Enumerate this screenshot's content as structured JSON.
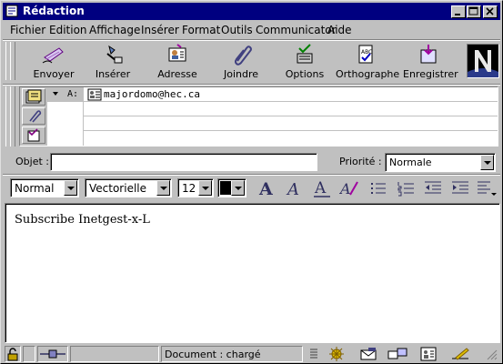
{
  "window": {
    "title": "Rédaction"
  },
  "menu": [
    {
      "label": "Fichier"
    },
    {
      "label": "Edition"
    },
    {
      "label": "Affichage"
    },
    {
      "label": "Insérer"
    },
    {
      "label": "Format"
    },
    {
      "label": "Outils"
    },
    {
      "label": "Communicator"
    },
    {
      "label": "Aide"
    }
  ],
  "toolbar": [
    {
      "label": "Envoyer",
      "icon": "send-icon"
    },
    {
      "label": "Insérer",
      "icon": "insert-icon"
    },
    {
      "label": "Adresse",
      "icon": "address-book-icon"
    },
    {
      "label": "Joindre",
      "icon": "attach-icon"
    },
    {
      "label": "Options",
      "icon": "options-icon"
    },
    {
      "label": "Orthographe",
      "icon": "spelling-icon"
    },
    {
      "label": "Enregistrer",
      "icon": "save-icon"
    }
  ],
  "address": {
    "recipient_type": "A:",
    "recipient": "majordomo@hec.ca"
  },
  "subject": {
    "label": "Objet :",
    "value": ""
  },
  "priority": {
    "label": "Priorité :",
    "value": "Normale"
  },
  "format": {
    "paragraph_style": "Normal",
    "font": "Vectorielle",
    "size": "12",
    "text_color": "#000000"
  },
  "body": {
    "text": "Subscribe Inetgest-x-L"
  },
  "status": {
    "text": "Document : chargé"
  }
}
